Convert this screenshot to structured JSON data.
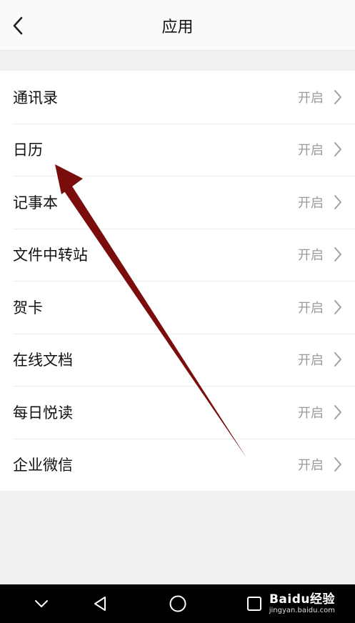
{
  "header": {
    "title": "应用"
  },
  "list": {
    "items": [
      {
        "label": "通讯录",
        "status": "开启"
      },
      {
        "label": "日历",
        "status": "开启"
      },
      {
        "label": "记事本",
        "status": "开启"
      },
      {
        "label": "文件中转站",
        "status": "开启"
      },
      {
        "label": "贺卡",
        "status": "开启"
      },
      {
        "label": "在线文档",
        "status": "开启"
      },
      {
        "label": "每日悦读",
        "status": "开启"
      },
      {
        "label": "企业微信",
        "status": "开启"
      }
    ]
  },
  "watermark": {
    "brand": "Baidu经验",
    "url": "jingyan.baidu.com"
  },
  "colors": {
    "arrow": "#7a0c0c",
    "status": "#9a9a9a",
    "navbar": "#000000"
  },
  "icons": [
    "back-arrow-icon",
    "chevron-right-icon",
    "nav-down-icon",
    "nav-back-icon",
    "nav-home-icon",
    "nav-recents-icon"
  ]
}
